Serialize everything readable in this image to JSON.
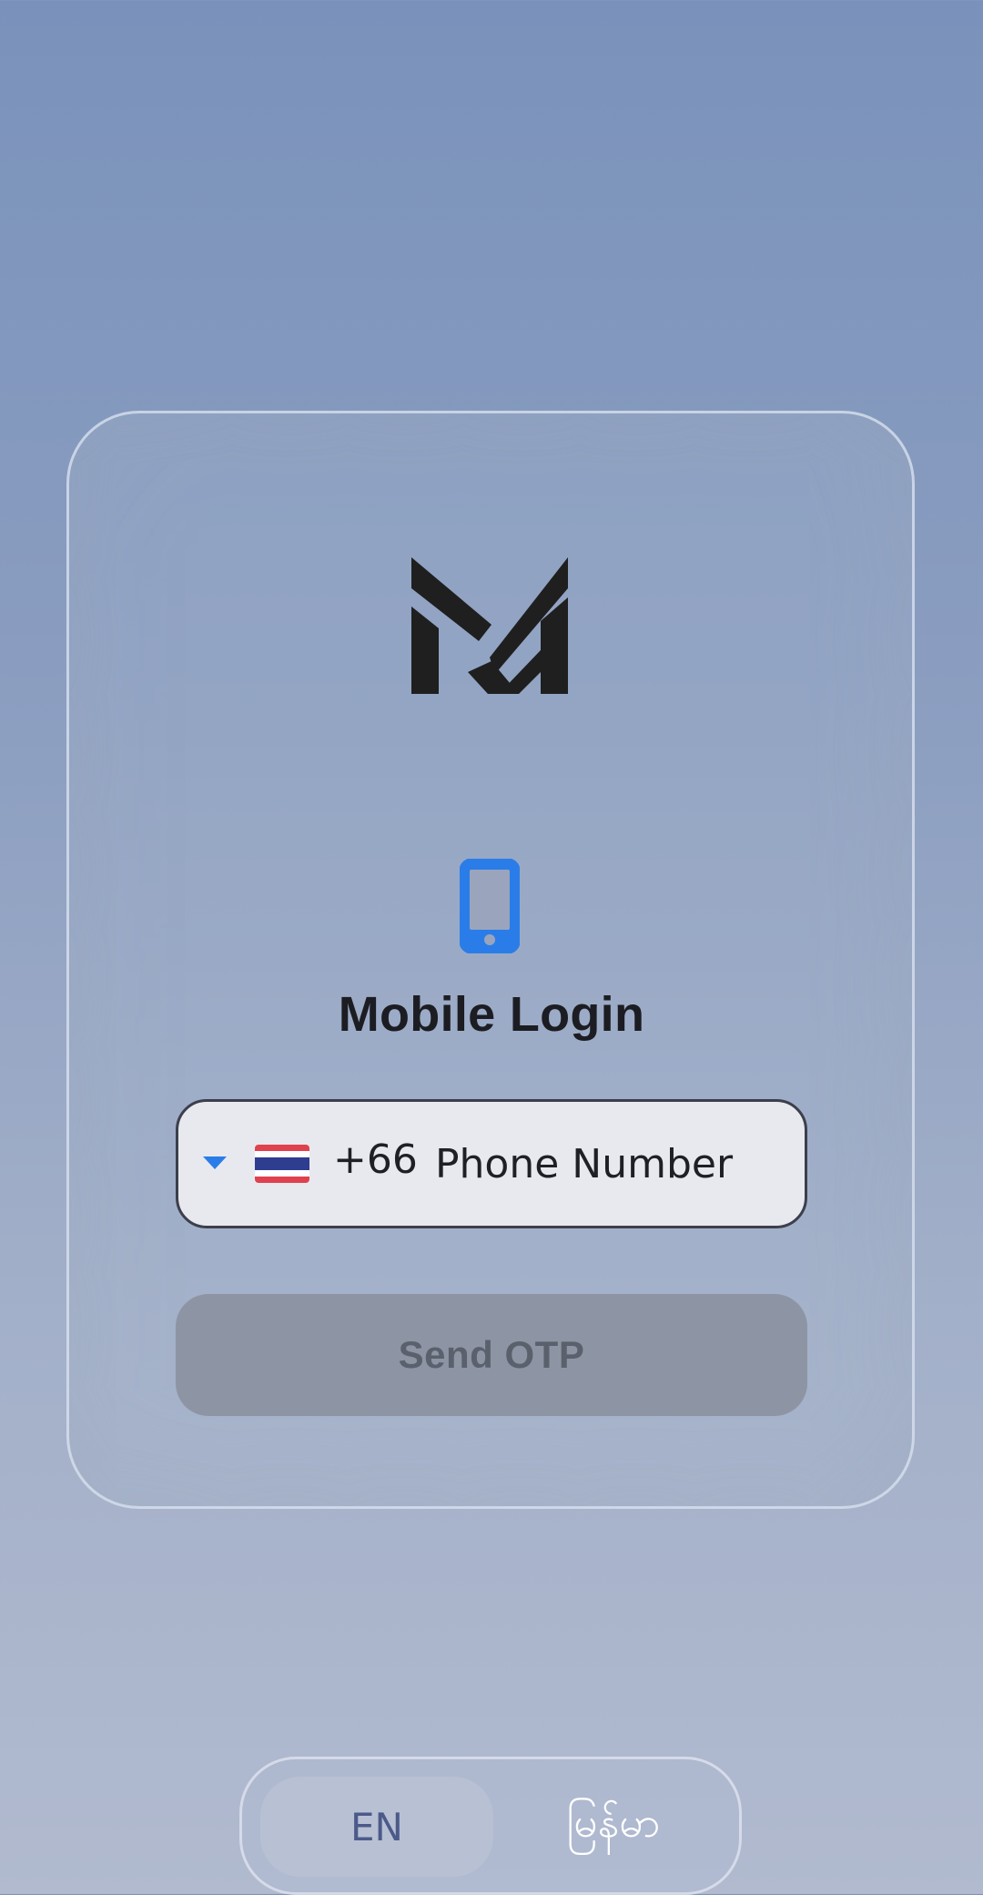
{
  "login": {
    "title": "Mobile Login",
    "country_flag": "thailand-flag-icon",
    "dial_code": "+66",
    "phone_placeholder": "Phone Number",
    "phone_value": "",
    "send_button_label": "Send OTP",
    "send_button_enabled": false
  },
  "language": {
    "options": [
      "EN",
      "မြန်မာ"
    ],
    "selected": "EN"
  },
  "colors": {
    "accent": "#2a7de8",
    "logo": "#1f1f1f",
    "disabled_button": "#8d95a4"
  }
}
